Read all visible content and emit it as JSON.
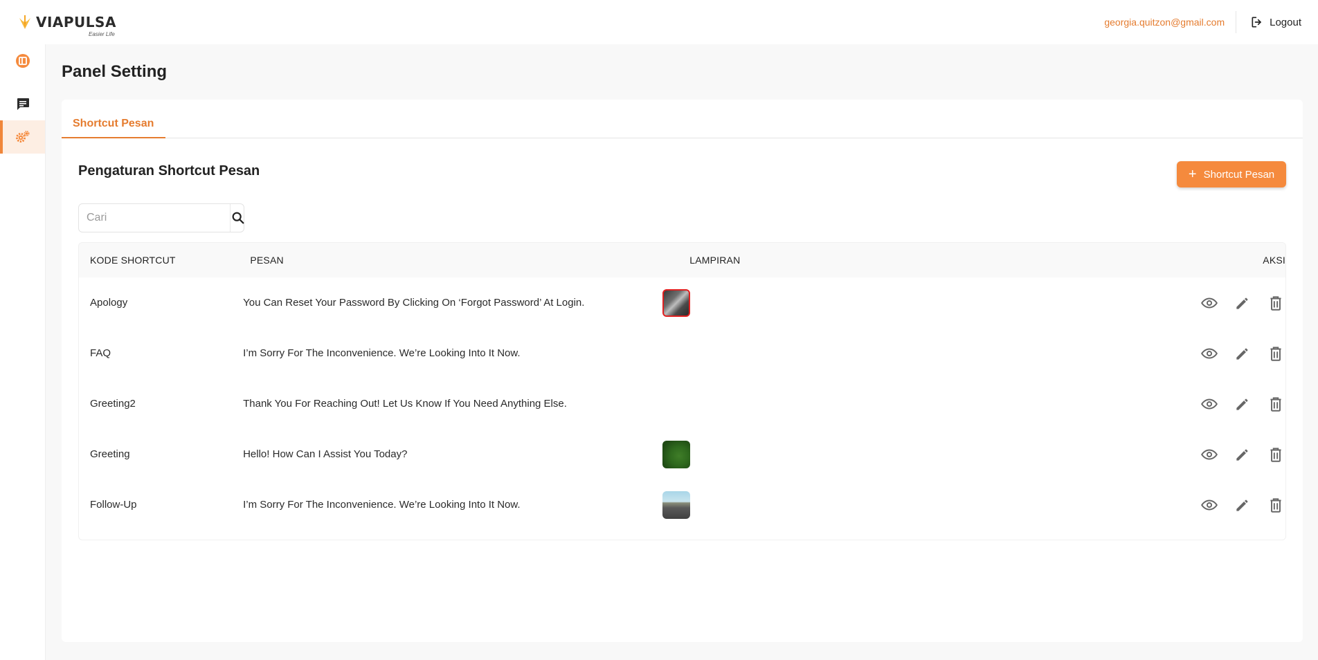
{
  "brand": {
    "name": "VIAPULSA",
    "tagline": "Easier Life",
    "accent": "#f58a3d"
  },
  "header": {
    "user_email": "georgia.quitzon@gmail.com",
    "logout_label": "Logout"
  },
  "sidebar": {
    "items": [
      {
        "icon": "dashboard-icon",
        "active": false
      },
      {
        "icon": "chat-icon",
        "active": false
      },
      {
        "icon": "settings-icon",
        "active": true
      }
    ]
  },
  "page": {
    "title": "Panel Setting",
    "tabs": [
      {
        "label": "Shortcut Pesan",
        "active": true
      }
    ],
    "section_title": "Pengaturan Shortcut Pesan",
    "add_button_label": "Shortcut Pesan",
    "search": {
      "placeholder": "Cari",
      "value": ""
    }
  },
  "table": {
    "columns": [
      "KODE SHORTCUT",
      "PESAN",
      "LAMPIRAN",
      "AKSI"
    ],
    "rows": [
      {
        "code": "Apology",
        "message": "You Can Reset Your Password By Clicking On ‘Forgot Password’ At Login.",
        "attachment": "image-thumbnail-dark"
      },
      {
        "code": "FAQ",
        "message": "I’m Sorry For The Inconvenience. We’re Looking Into It Now.",
        "attachment": ""
      },
      {
        "code": "Greeting2",
        "message": "Thank You For Reaching Out! Let Us Know If You Need Anything Else.",
        "attachment": ""
      },
      {
        "code": "Greeting",
        "message": "Hello! How Can I Assist You Today?",
        "attachment": "image-thumbnail-green"
      },
      {
        "code": "Follow-Up",
        "message": "I’m Sorry For The Inconvenience. We’re Looking Into It Now.",
        "attachment": "image-thumbnail-road"
      }
    ],
    "action_icons": [
      "view-icon",
      "edit-icon",
      "delete-icon"
    ]
  }
}
